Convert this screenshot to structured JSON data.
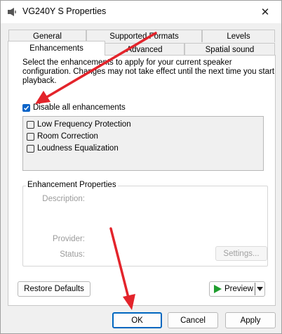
{
  "window": {
    "title": "VG240Y S Properties",
    "close_glyph": "✕"
  },
  "tabs_row1": [
    "General",
    "Supported Formats",
    "Levels"
  ],
  "tabs_row2": [
    "Enhancements",
    "Advanced",
    "Spatial sound"
  ],
  "active_tab": "Enhancements",
  "enhancements": {
    "description": "Select the enhancements to apply for your current speaker configuration. Changes may not take effect until the next time you start playback.",
    "disable_all": {
      "label": "Disable all enhancements",
      "checked": true
    },
    "items": [
      {
        "label": "Low Frequency Protection",
        "checked": false
      },
      {
        "label": "Room Correction",
        "checked": false
      },
      {
        "label": "Loudness Equalization",
        "checked": false
      }
    ]
  },
  "properties": {
    "legend": "Enhancement Properties",
    "description_label": "Description:",
    "provider_label": "Provider:",
    "status_label": "Status:",
    "settings_button": "Settings..."
  },
  "buttons": {
    "restore_defaults": "Restore Defaults",
    "preview": "Preview",
    "ok": "OK",
    "cancel": "Cancel",
    "apply": "Apply"
  },
  "colors": {
    "accent": "#0a64c8",
    "annotation_arrow": "#e3242b",
    "preview_play": "#1f9d2e"
  }
}
